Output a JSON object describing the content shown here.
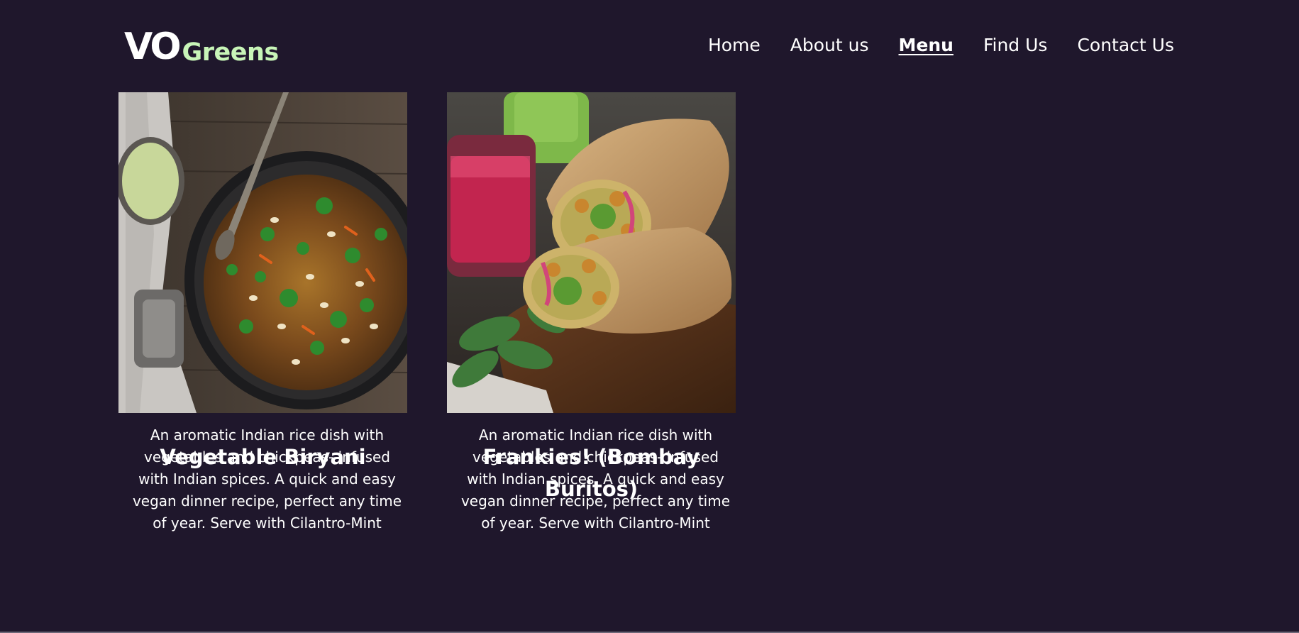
{
  "brand": {
    "logo_main": "VO",
    "logo_sub": "Greens",
    "accent_color": "#c8f5b8",
    "background_color": "#1f172c"
  },
  "nav": {
    "items": [
      {
        "label": "Home"
      },
      {
        "label": "About us"
      },
      {
        "label": "Menu",
        "active": true
      },
      {
        "label": "Find Us"
      },
      {
        "label": "Contact Us"
      }
    ]
  },
  "menu": {
    "items": [
      {
        "title": "Vegetable Biryani",
        "description": "An aromatic Indian rice dish with vegetables and chickpeas- infused with Indian spices. A quick and easy vegan dinner recipe, perfect any time of year. Serve with Cilantro-Mint",
        "image": "biryani-pot-photo"
      },
      {
        "title": "Frankies! (Bombay Buritos)",
        "description": "An aromatic Indian rice dish with vegetables and chickpeas- infused with Indian spices. A quick and easy vegan dinner recipe, perfect any time of year. Serve with Cilantro-Mint",
        "image": "frankie-wrap-photo"
      }
    ]
  }
}
